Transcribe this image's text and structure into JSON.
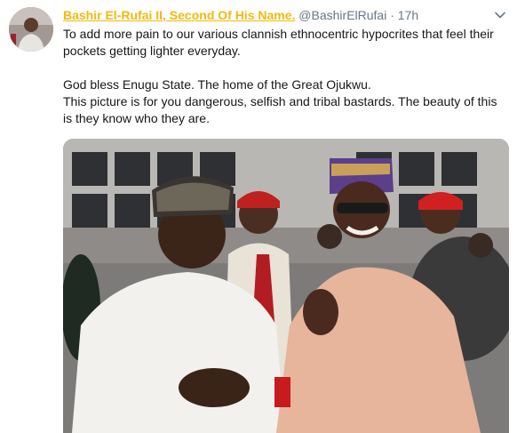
{
  "tweet": {
    "display_name": "Bashir El-Rufai II, Second Of His Name.",
    "handle": "@BashirElRufai",
    "separator": "·",
    "timestamp": "17h",
    "lines": [
      "To add more pain to our various clannish ethnocentric hypocrites that feel their pockets getting lighter everyday.",
      "God bless Enugu State. The home of the Great Ojukwu.",
      " This picture is for you dangerous, selfish and tribal bastards. The beauty of this is they know who they are."
    ]
  },
  "colors": {
    "name": "#f2b90c",
    "meta": "#657786",
    "text": "#14171a"
  },
  "icons": {
    "menu": "chevron-down-icon"
  }
}
